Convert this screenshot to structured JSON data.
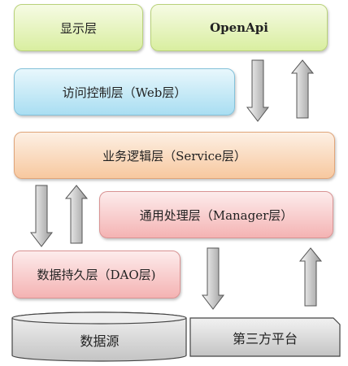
{
  "layers": {
    "display": "显示层",
    "openapi": "OpenApi",
    "web": "访问控制层（Web层）",
    "service": "业务逻辑层（Service层）",
    "manager": "通用处理层（Manager层）",
    "dao": "数据持久层（DAO层)",
    "datasource": "数据源",
    "third_party": "第三方平台"
  },
  "colors": {
    "display": "#d9eea0",
    "web": "#a9def2",
    "service": "#f7c89f",
    "manager": "#f4b3b3",
    "storage": "#d0d0d0"
  }
}
